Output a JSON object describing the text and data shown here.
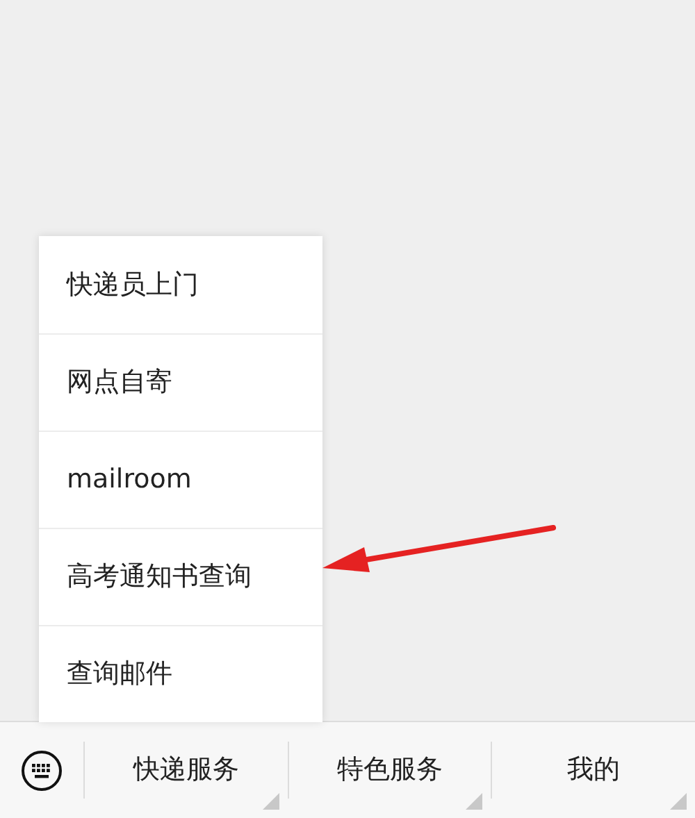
{
  "popup_menu": {
    "items": [
      {
        "label": "快递员上门"
      },
      {
        "label": "网点自寄"
      },
      {
        "label": "mailroom"
      },
      {
        "label": "高考通知书查询"
      },
      {
        "label": "查询邮件"
      }
    ]
  },
  "bottom_menu": {
    "tabs": [
      {
        "label": "快递服务"
      },
      {
        "label": "特色服务"
      },
      {
        "label": "我的"
      }
    ]
  }
}
